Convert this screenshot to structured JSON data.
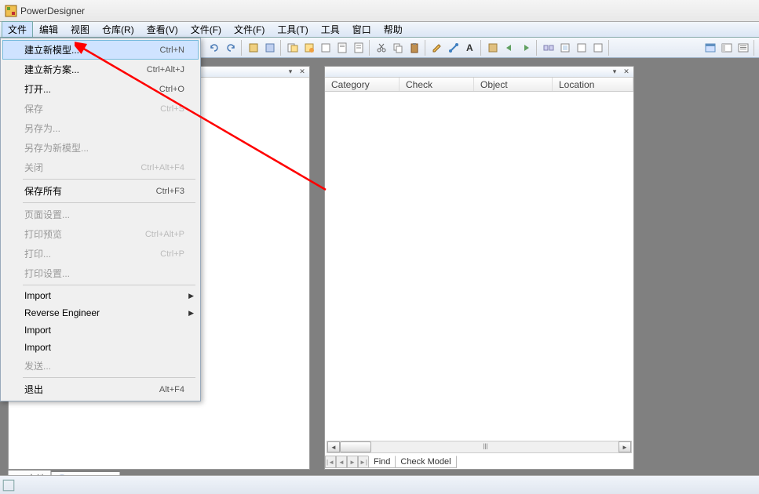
{
  "window": {
    "title": "PowerDesigner"
  },
  "menubar": {
    "items": [
      "文件",
      "编辑",
      "视图",
      "仓库(R)",
      "查看(V)",
      "文件(F)",
      "文件(F)",
      "工具(T)",
      "工具",
      "窗口",
      "帮助"
    ],
    "activeIndex": 0
  },
  "fileMenu": {
    "items": [
      {
        "label": "建立新模型...",
        "shortcut": "Ctrl+N",
        "highlight": true
      },
      {
        "label": "建立新方案...",
        "shortcut": "Ctrl+Alt+J"
      },
      {
        "label": "打开...",
        "shortcut": "Ctrl+O"
      },
      {
        "label": "保存",
        "shortcut": "Ctrl+S",
        "disabled": true
      },
      {
        "label": "另存为...",
        "disabled": true
      },
      {
        "label": "另存为新模型...",
        "disabled": true
      },
      {
        "label": "关闭",
        "shortcut": "Ctrl+Alt+F4",
        "disabled": true
      },
      {
        "sep": true
      },
      {
        "label": "保存所有",
        "shortcut": "Ctrl+F3"
      },
      {
        "sep": true
      },
      {
        "label": "页面设置...",
        "disabled": true
      },
      {
        "label": "打印预览",
        "shortcut": "Ctrl+Alt+P",
        "disabled": true
      },
      {
        "label": "打印...",
        "shortcut": "Ctrl+P",
        "disabled": true
      },
      {
        "label": "打印设置...",
        "disabled": true
      },
      {
        "sep": true
      },
      {
        "label": "Import",
        "submenu": true
      },
      {
        "label": "Reverse Engineer",
        "submenu": true
      },
      {
        "label": "Import"
      },
      {
        "label": "Import"
      },
      {
        "label": "发送...",
        "disabled": true
      },
      {
        "sep": true
      },
      {
        "label": "退出",
        "shortcut": "Alt+F4"
      }
    ]
  },
  "rightPanel": {
    "columns": [
      "Category",
      "Check",
      "Object",
      "Location"
    ],
    "tabs": [
      "Find",
      "Check Model"
    ]
  },
  "leftTabs": {
    "items": [
      "本地",
      "Repository"
    ]
  }
}
